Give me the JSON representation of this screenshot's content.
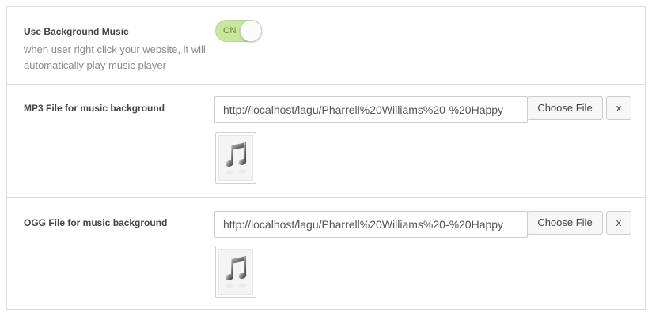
{
  "settings": {
    "background_music": {
      "label": "Use Background Music",
      "description": "when user right click your website, it will automatically play music player",
      "toggle_state": "ON"
    },
    "mp3": {
      "label": "MP3 File for music background",
      "url": "http://localhost/lagu/Pharrell%20Williams%20-%20Happy",
      "choose_label": "Choose File",
      "remove_label": "x",
      "thumbnail_icon": "music-note-icon"
    },
    "ogg": {
      "label": "OGG File for music background",
      "url": "http://localhost/lagu/Pharrell%20Williams%20-%20Happy",
      "choose_label": "Choose File",
      "remove_label": "x",
      "thumbnail_icon": "music-note-icon"
    }
  },
  "colors": {
    "toggle_on": "#c8e6a0",
    "toggle_text": "#5b7f2a",
    "border": "#dcdcdc"
  }
}
